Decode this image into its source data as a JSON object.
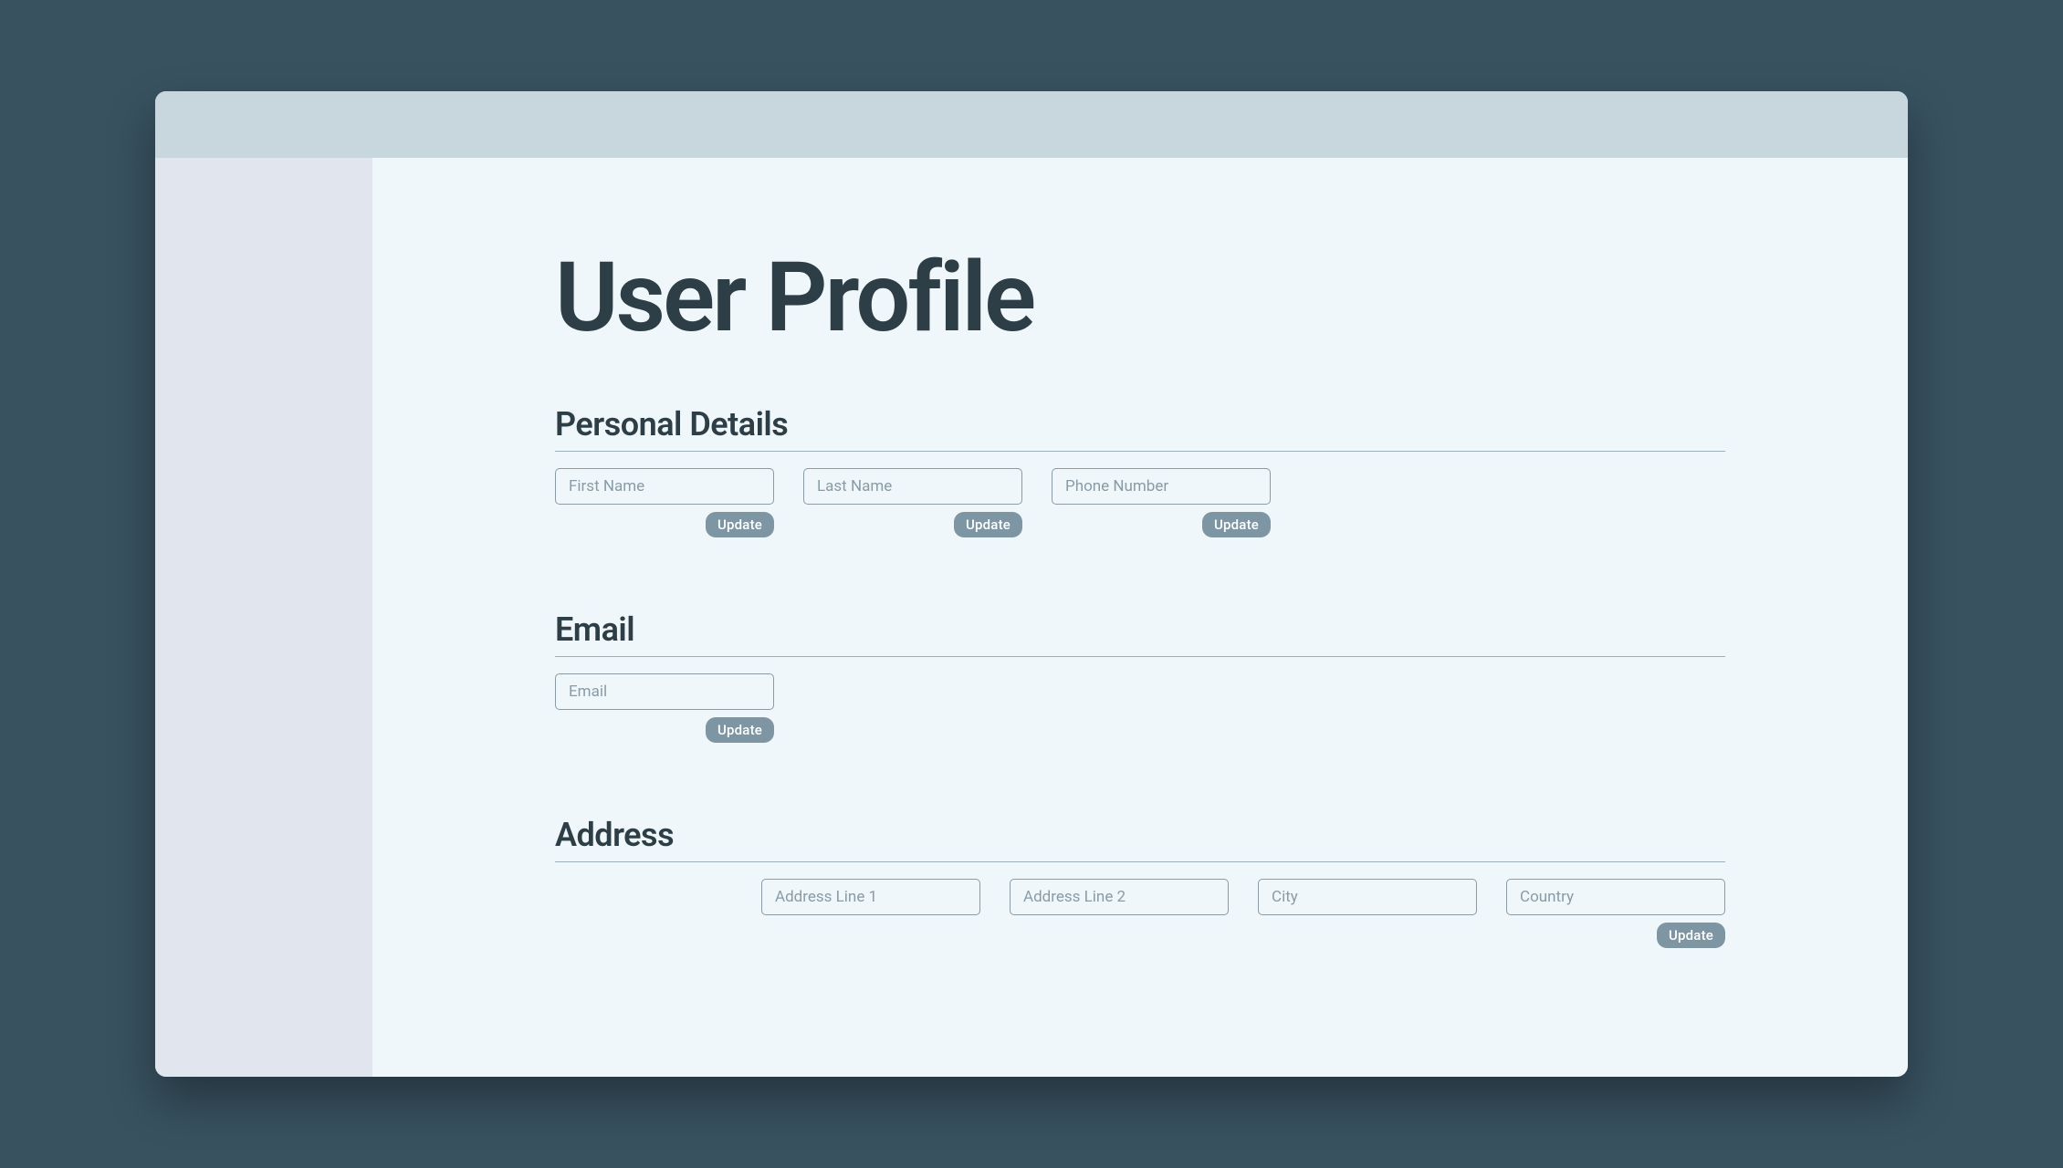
{
  "page": {
    "title": "User Profile"
  },
  "sections": {
    "personal": {
      "heading": "Personal Details",
      "fields": {
        "firstName": {
          "placeholder": "First Name",
          "value": ""
        },
        "lastName": {
          "placeholder": "Last Name",
          "value": ""
        },
        "phone": {
          "placeholder": "Phone Number",
          "value": ""
        }
      }
    },
    "email": {
      "heading": "Email",
      "fields": {
        "email": {
          "placeholder": "Email",
          "value": ""
        }
      }
    },
    "address": {
      "heading": "Address",
      "fields": {
        "line1": {
          "placeholder": "Address Line 1",
          "value": ""
        },
        "line2": {
          "placeholder": "Address Line 2",
          "value": ""
        },
        "city": {
          "placeholder": "City",
          "value": ""
        },
        "country": {
          "placeholder": "Country",
          "value": ""
        }
      }
    }
  },
  "buttons": {
    "update": "Update"
  }
}
